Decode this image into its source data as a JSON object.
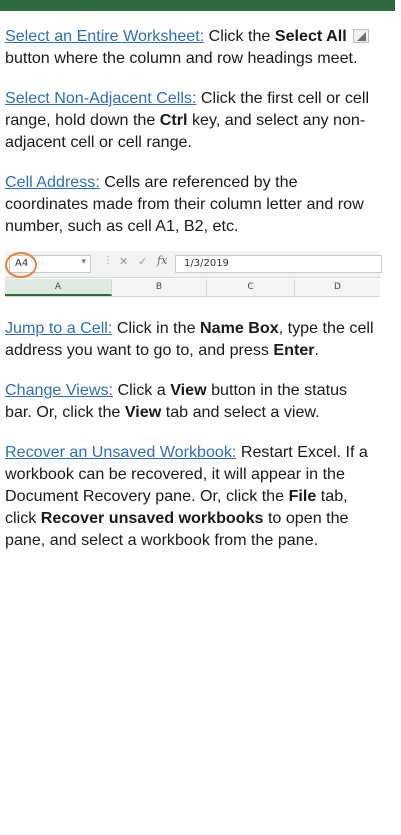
{
  "tips": {
    "select_all": {
      "link": "Select an Entire Worksheet:",
      "t1": " Click the ",
      "b1": "Select All",
      "t2": " button where the column and row headings meet."
    },
    "non_adjacent": {
      "link": "Select Non-Adjacent Cells:",
      "t1": " Click the first cell or cell range, hold down the ",
      "b1": "Ctrl",
      "t2": " key, and select any non-adjacent cell or cell range."
    },
    "cell_address": {
      "link": "Cell Address:",
      "t1": " Cells are referenced by the coordinates made from their column letter and row number, such as cell A1, B2, etc."
    },
    "jump": {
      "link": "Jump to a Cell:",
      "t1": " Click in the ",
      "b1": "Name Box",
      "t2": ", type the cell address you want to go to, and press ",
      "b2": "Enter",
      "t3": "."
    },
    "views": {
      "link": "Change Views:",
      "t1": " Click a ",
      "b1": "View",
      "t2": " button in the status bar. Or, click the ",
      "b2": "View",
      "t3": " tab and select a view."
    },
    "recover": {
      "link": "Recover an Unsaved Workbook:",
      "t1": " Restart Excel. If a workbook can be recovered, it will appear in the Document Recovery pane. Or, click the ",
      "b1": "File",
      "t2": " tab, click ",
      "b2": "Recover unsaved workbooks",
      "t3": " to open the pane, and select a workbook from the pane."
    }
  },
  "screenshot": {
    "name_box": "A4",
    "formula": "1/3/2019",
    "fx": "fx",
    "columns": [
      "A",
      "B",
      "C",
      "D"
    ]
  },
  "colors": {
    "link": "#2f6fb8",
    "accent_bar": "#2e6b3e",
    "highlight_circle": "#e8823a"
  }
}
